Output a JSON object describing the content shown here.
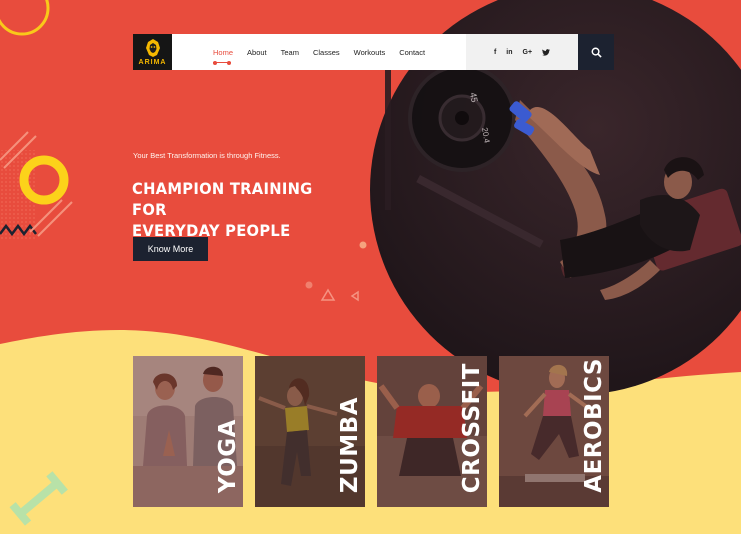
{
  "colors": {
    "primary": "#e84c3d",
    "dark": "#1c2230",
    "yellow": "#fde07a",
    "accent": "#f5b800"
  },
  "nav": {
    "logo_text": "ARIMA",
    "links": [
      {
        "label": "Home",
        "active": true
      },
      {
        "label": "About",
        "active": false
      },
      {
        "label": "Team",
        "active": false
      },
      {
        "label": "Classes",
        "active": false
      },
      {
        "label": "Workouts",
        "active": false
      },
      {
        "label": "Contact",
        "active": false
      }
    ],
    "social": [
      "f",
      "in",
      "G+",
      "twitter-icon"
    ],
    "search_icon": "search-icon"
  },
  "hero": {
    "subtitle": "Your Best Transformation is through Fitness.",
    "title_line1": "CHAMPION TRAINING FOR",
    "title_line2": "EVERYDAY PEOPLE",
    "button_label": "Know More",
    "image": "athlete-leg-press-photo"
  },
  "classes": [
    {
      "label": "YOGA"
    },
    {
      "label": "ZUMBA"
    },
    {
      "label": "CROSSFIT"
    },
    {
      "label": "AEROBICS"
    }
  ]
}
